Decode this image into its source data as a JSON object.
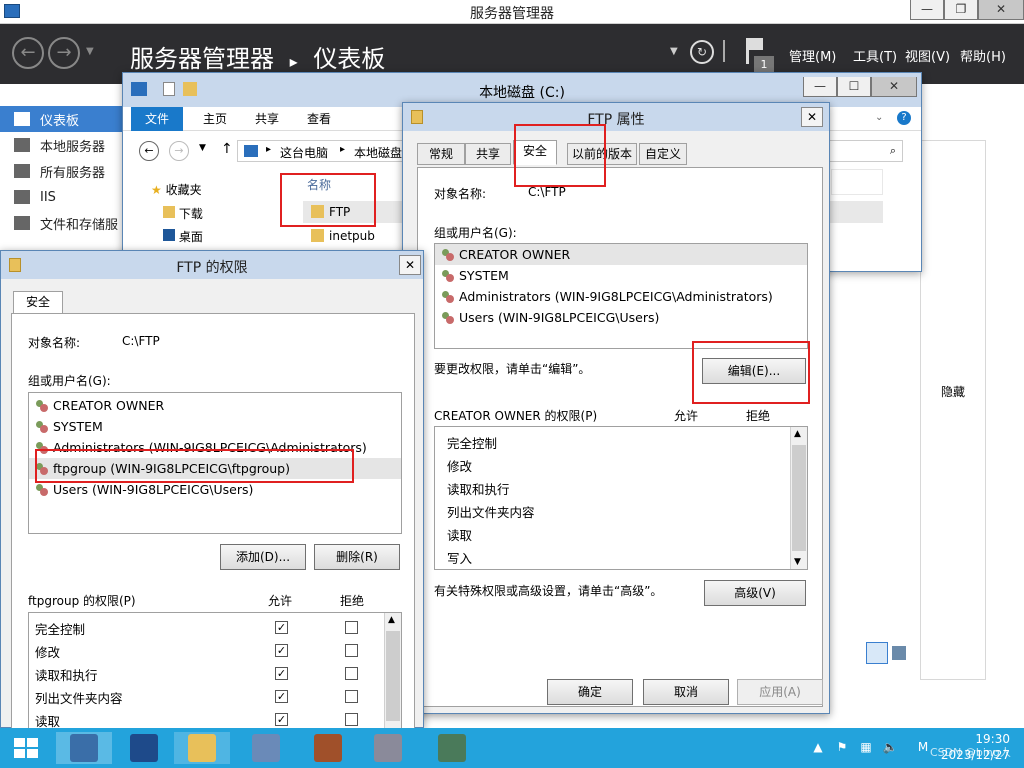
{
  "server_manager": {
    "window_title": "服务器管理器",
    "breadcrumb": [
      "服务器管理器",
      "仪表板"
    ],
    "notification_count": "1",
    "menus": [
      "管理(M)",
      "工具(T)",
      "视图(V)",
      "帮助(H)"
    ],
    "sidebar": [
      {
        "label": "仪表板",
        "active": true
      },
      {
        "label": "本地服务器"
      },
      {
        "label": "所有服务器"
      },
      {
        "label": "IIS"
      },
      {
        "label": "文件和存储服"
      }
    ],
    "hidden_label": "隐藏"
  },
  "explorer": {
    "title": "本地磁盘 (C:)",
    "ribbon_tabs": [
      "文件",
      "主页",
      "共享",
      "查看"
    ],
    "address": [
      "这台电脑",
      "本地磁盘"
    ],
    "nav": [
      "收藏夹",
      "下载",
      "桌面"
    ],
    "column_header": "名称",
    "files": [
      "FTP",
      "inetpub"
    ]
  },
  "ftp_properties": {
    "title": "FTP 属性",
    "tabs": [
      "常规",
      "共享",
      "安全",
      "以前的版本",
      "自定义"
    ],
    "object_label": "对象名称:",
    "object_value": "C:\\FTP",
    "group_label": "组或用户名(G):",
    "users": [
      "CREATOR OWNER",
      "SYSTEM",
      "Administrators (WIN-9IG8LPCEICG\\Administrators)",
      "Users (WIN-9IG8LPCEICG\\Users)"
    ],
    "edit_hint": "要更改权限，请单击“编辑”。",
    "edit_button": "编辑(E)...",
    "perm_title": "CREATOR OWNER 的权限(P)",
    "allow": "允许",
    "deny": "拒绝",
    "permissions": [
      "完全控制",
      "修改",
      "读取和执行",
      "列出文件夹内容",
      "读取",
      "写入"
    ],
    "advanced_hint": "有关特殊权限或高级设置，请单击“高级”。",
    "advanced_button": "高级(V)",
    "ok": "确定",
    "cancel": "取消",
    "apply": "应用(A)"
  },
  "ftp_permissions": {
    "title": "FTP 的权限",
    "tab": "安全",
    "object_label": "对象名称:",
    "object_value": "C:\\FTP",
    "group_label": "组或用户名(G):",
    "users": [
      "CREATOR OWNER",
      "SYSTEM",
      "Administrators (WIN-9IG8LPCEICG\\Administrators)",
      "ftpgroup (WIN-9IG8LPCEICG\\ftpgroup)",
      "Users (WIN-9IG8LPCEICG\\Users)"
    ],
    "add_button": "添加(D)...",
    "remove_button": "删除(R)",
    "perm_title": "ftpgroup 的权限(P)",
    "allow": "允许",
    "deny": "拒绝",
    "permissions": [
      {
        "name": "完全控制",
        "allow": "✓",
        "deny": ""
      },
      {
        "name": "修改",
        "allow": "✓",
        "deny": ""
      },
      {
        "name": "读取和执行",
        "allow": "✓",
        "deny": ""
      },
      {
        "name": "列出文件夹内容",
        "allow": "✓",
        "deny": ""
      },
      {
        "name": "读取",
        "allow": "✓",
        "deny": ""
      }
    ]
  },
  "taskbar": {
    "time": "19:30",
    "date": "2023/12/27",
    "watermark": "CSDN @bing人"
  },
  "colors": {
    "accent": "#3a7fcf",
    "highlight": "#e02020",
    "taskbar": "#23a3dc"
  }
}
